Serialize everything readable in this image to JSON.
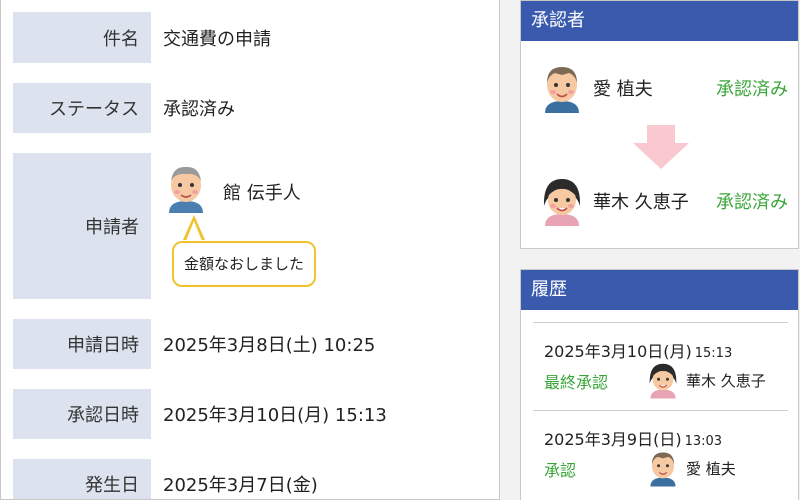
{
  "details": {
    "subject_label": "件名",
    "subject_value": "交通費の申請",
    "status_label": "ステータス",
    "status_value": "承認済み",
    "applicant_label": "申請者",
    "applicant_name": "館 伝手人",
    "applicant_comment": "金額なおしました",
    "applied_at_label": "申請日時",
    "applied_at_value": "2025年3月8日(土) 10:25",
    "approved_at_label": "承認日時",
    "approved_at_value": "2025年3月10日(月) 15:13",
    "occurred_label": "発生日",
    "occurred_value": "2025年3月7日(金)"
  },
  "approvers": {
    "title": "承認者",
    "items": [
      {
        "name": "愛 植夫",
        "status": "承認済み",
        "avatar": "older-man-avatar"
      },
      {
        "name": "華木 久恵子",
        "status": "承認済み",
        "avatar": "woman-avatar"
      }
    ]
  },
  "history": {
    "title": "履歴",
    "items": [
      {
        "date": "2025年3月10日(月)",
        "time": "15:13",
        "action": "最終承認",
        "name": "華木 久恵子",
        "avatar": "woman-avatar"
      },
      {
        "date": "2025年3月9日(日)",
        "time": "13:03",
        "action": "承認",
        "name": "愛 植夫",
        "avatar": "older-man-avatar"
      }
    ]
  },
  "colors": {
    "header_blue": "#3a5aad",
    "label_bg": "#dce3ee",
    "approved_green": "#3aa63a",
    "bubble_border": "#f0c22c",
    "arrow_pink": "#f9c9cf"
  }
}
